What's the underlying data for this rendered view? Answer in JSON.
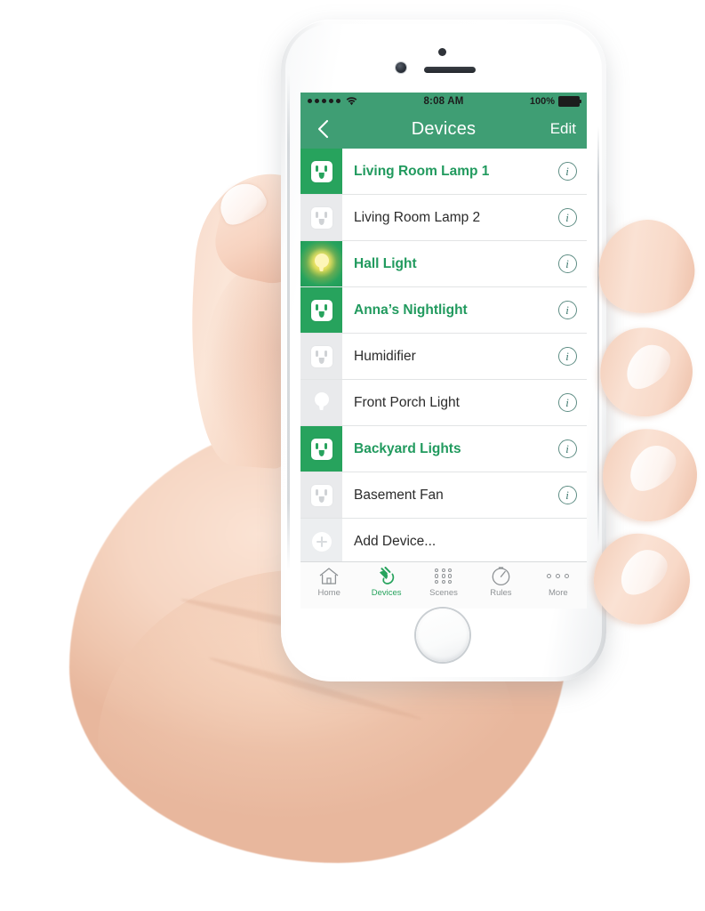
{
  "status_bar": {
    "signal_dots": 5,
    "wifi_icon": "wifi-icon",
    "time": "8:08 AM",
    "battery_percent": "100%"
  },
  "nav_bar": {
    "back_icon": "chevron-left-icon",
    "title": "Devices",
    "edit_label": "Edit"
  },
  "devices": [
    {
      "name": "Living Room Lamp 1",
      "icon": "outlet-icon",
      "state": "on",
      "info_label": "i"
    },
    {
      "name": "Living Room Lamp 2",
      "icon": "outlet-icon",
      "state": "off",
      "info_label": "i"
    },
    {
      "name": "Hall Light",
      "icon": "lightbulb-icon",
      "state": "on",
      "info_label": "i"
    },
    {
      "name": "Anna’s Nightlight",
      "icon": "outlet-icon",
      "state": "on",
      "info_label": "i"
    },
    {
      "name": "Humidifier",
      "icon": "outlet-icon",
      "state": "off",
      "info_label": "i"
    },
    {
      "name": "Front Porch Light",
      "icon": "lightbulb-icon",
      "state": "off",
      "info_label": "i"
    },
    {
      "name": "Backyard Lights",
      "icon": "outlet-icon",
      "state": "on",
      "info_label": "i"
    },
    {
      "name": "Basement Fan",
      "icon": "outlet-icon",
      "state": "off",
      "info_label": "i"
    }
  ],
  "add_device": {
    "label": "Add Device...",
    "icon": "plus-circle-icon"
  },
  "tab_bar": {
    "tabs": [
      {
        "label": "Home",
        "icon": "house-icon",
        "active": false
      },
      {
        "label": "Devices",
        "icon": "plug-icon",
        "active": true
      },
      {
        "label": "Scenes",
        "icon": "dot-grid-icon",
        "active": false
      },
      {
        "label": "Rules",
        "icon": "clock-icon",
        "active": false
      },
      {
        "label": "More",
        "icon": "ellipsis-icon",
        "active": false
      }
    ]
  },
  "colors": {
    "header_green": "#3f9e74",
    "accent_green": "#27a35d",
    "on_text_green": "#219a5e",
    "off_tile_gray": "#e9eaec",
    "bulb_yellow": "#fdf6b8",
    "info_teal": "#3f7a70",
    "tab_inactive": "#8e9295"
  },
  "hardware": {
    "home_button": "home-button",
    "camera": "front-camera",
    "earpiece": "earpiece-speaker"
  }
}
